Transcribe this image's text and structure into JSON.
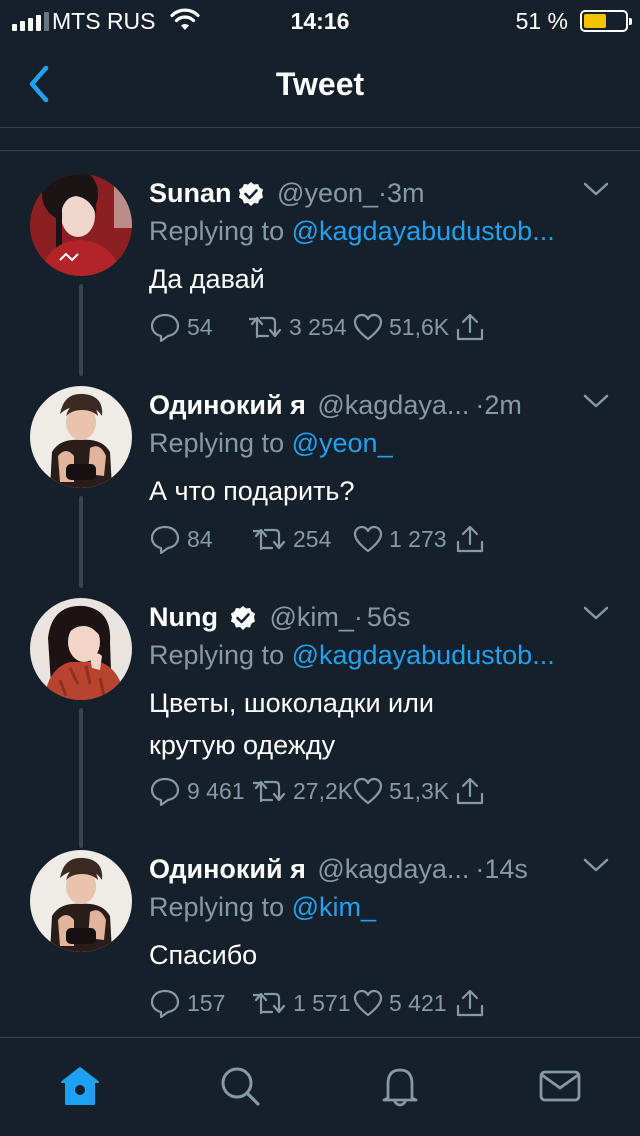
{
  "status_bar": {
    "carrier": "MTS RUS",
    "time": "14:16",
    "battery_percent": "51 %",
    "battery_level": 0.51
  },
  "nav": {
    "title": "Tweet"
  },
  "tweets": [
    {
      "name": "Sunan",
      "verified": true,
      "handle": "@yeon_",
      "dot": "·",
      "time": "3m",
      "replying_prefix": "Replying to",
      "replying_to": "@kagdayabudustob...",
      "text": "Да давай",
      "replies": "54",
      "retweets": "3 254",
      "likes": "51,6K"
    },
    {
      "name": "Одинокий я",
      "verified": false,
      "handle": "@kagdaya...",
      "dot": "·",
      "time": "2m",
      "replying_prefix": "Replying to",
      "replying_to": "@yeon_",
      "text": "А что подарить?",
      "replies": "84",
      "retweets": "254",
      "likes": "1 273"
    },
    {
      "name": "Nung",
      "verified": true,
      "handle": "@kim_",
      "dot": "·",
      "time": "56s",
      "replying_prefix": "Replying to",
      "replying_to": "@kagdayabudustob...",
      "text_line1": "Цветы, шоколадки или",
      "text_line2": "крутую одежду",
      "replies": "9 461",
      "retweets": "27,2K",
      "likes": "51,3K"
    },
    {
      "name": "Одинокий я",
      "verified": false,
      "handle": "@kagdaya...",
      "dot": "·",
      "time": "14s",
      "replying_prefix": "Replying to",
      "replying_to": "@kim_",
      "text": "Спасибо",
      "replies": "157",
      "retweets": "1 571",
      "likes": "5 421"
    }
  ],
  "tabbar": {
    "items": [
      "home-icon",
      "search-icon",
      "notifications-icon",
      "messages-icon"
    ],
    "active": "home-icon"
  },
  "colors": {
    "background": "#15202b",
    "accent": "#1da1f2",
    "secondary_text": "#8899a6",
    "divider": "#38444d",
    "battery": "#f5c400"
  }
}
